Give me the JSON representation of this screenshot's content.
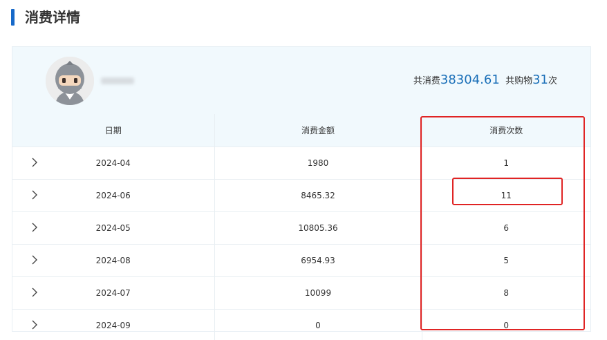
{
  "page": {
    "title": "消费详情"
  },
  "profile": {
    "summary": {
      "total_prefix": "共消费",
      "total_amount": "38304.61",
      "purchase_prefix": "共购物",
      "purchase_count": "31",
      "purchase_suffix": "次"
    }
  },
  "table": {
    "headers": {
      "date": "日期",
      "amount": "消费金额",
      "count": "消费次数"
    },
    "rows": [
      {
        "date": "2024-04",
        "amount": "1980",
        "count": "1"
      },
      {
        "date": "2024-06",
        "amount": "8465.32",
        "count": "11"
      },
      {
        "date": "2024-05",
        "amount": "10805.36",
        "count": "6"
      },
      {
        "date": "2024-08",
        "amount": "6954.93",
        "count": "5"
      },
      {
        "date": "2024-07",
        "amount": "10099",
        "count": "8"
      },
      {
        "date": "2024-09",
        "amount": "0",
        "count": "0"
      }
    ]
  },
  "colors": {
    "accent": "#1769c9",
    "number": "#1a6fb8",
    "highlight": "#e02424",
    "header_bg": "#f1f9fd"
  },
  "icons": {
    "expand": "chevron-right-icon"
  }
}
